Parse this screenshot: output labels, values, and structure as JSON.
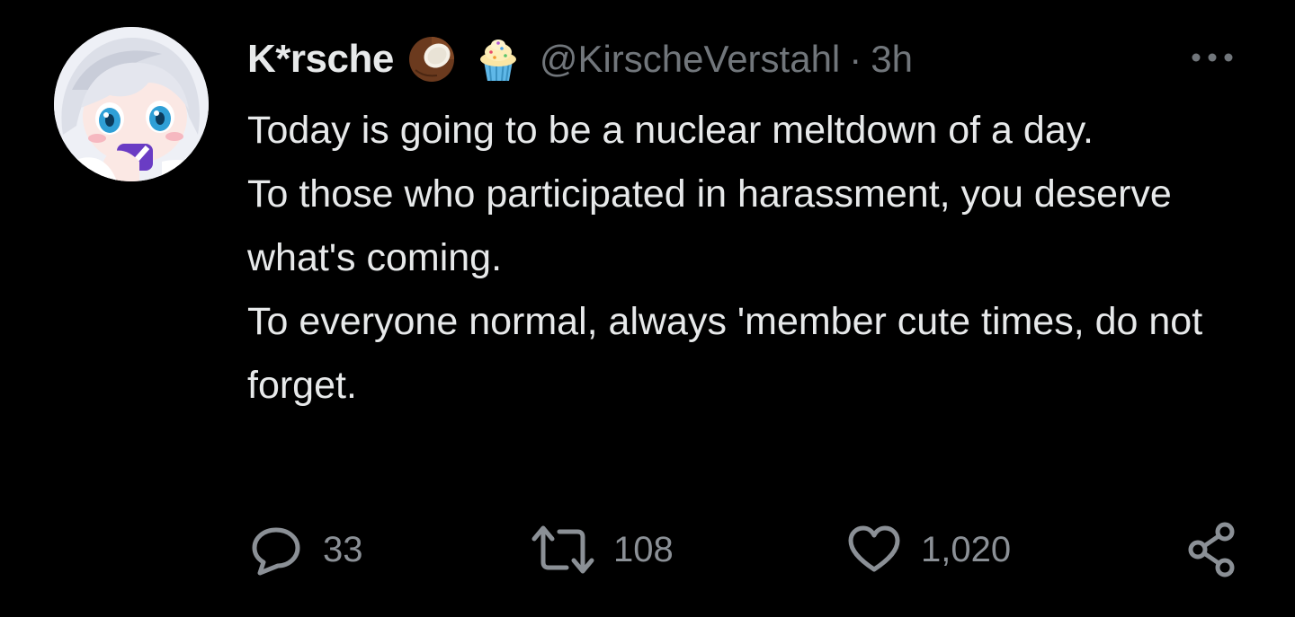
{
  "tweet": {
    "display_name": "K*rsche",
    "name_emojis": [
      "coconut-emoji",
      "cupcake-emoji"
    ],
    "handle": "@KirscheVerstahl",
    "separator": "·",
    "time": "3h",
    "lines": [
      "Today is going to be a nuclear meltdown of a day.",
      "To those who participated in harassment, you deserve what's coming.",
      "To everyone normal, always 'member cute times, do not forget."
    ]
  },
  "actions": {
    "reply_count": "33",
    "retweet_count": "108",
    "like_count": "1,020"
  },
  "colors": {
    "background": "#000000",
    "text": "#e7e9ea",
    "muted": "#71767b",
    "icon": "#8b9096"
  },
  "icons": {
    "more": "more-horizontal-icon",
    "reply": "reply-icon",
    "retweet": "retweet-icon",
    "like": "heart-icon",
    "share": "share-icon"
  }
}
